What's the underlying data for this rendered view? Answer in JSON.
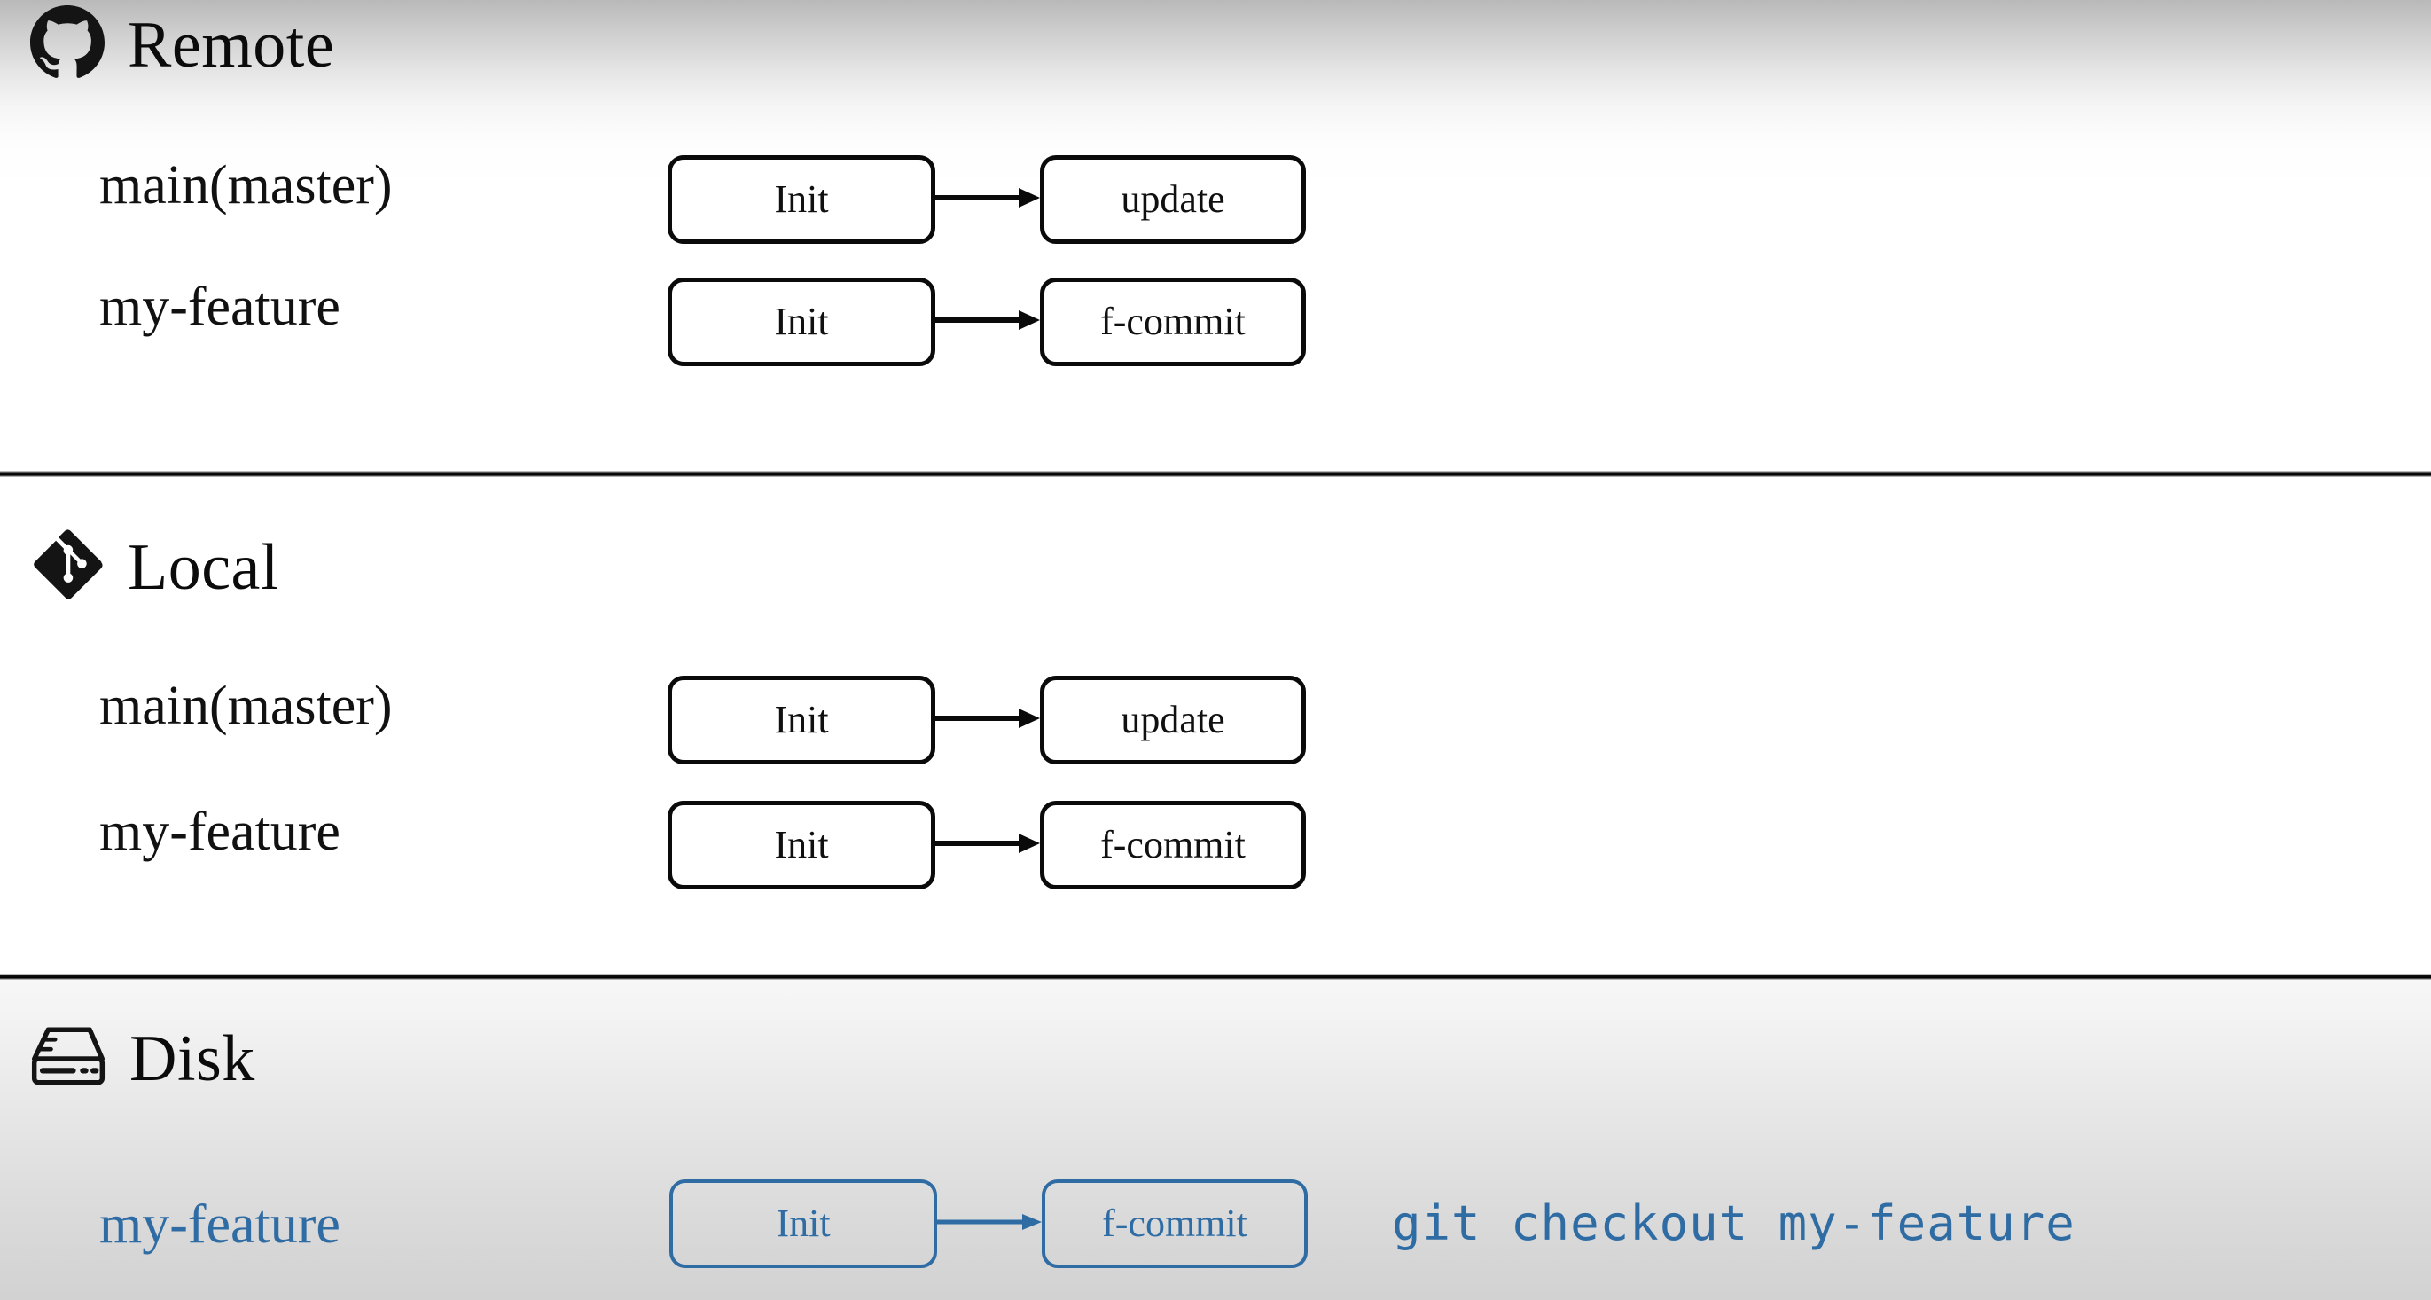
{
  "colors": {
    "accent_blue": "#2f6ca4",
    "ink": "#111111",
    "box_border": "#0a0a0a",
    "page_background": "#ffffff",
    "disk_background": "#dedede"
  },
  "sections": [
    {
      "id": "remote",
      "title": "Remote",
      "icon": "github-icon",
      "rows": [
        {
          "label": "main(master)",
          "accent": false,
          "commits": [
            "Init",
            "update"
          ]
        },
        {
          "label": "my-feature",
          "accent": false,
          "commits": [
            "Init",
            "f-commit"
          ]
        }
      ]
    },
    {
      "id": "local",
      "title": "Local",
      "icon": "git-icon",
      "rows": [
        {
          "label": "main(master)",
          "accent": false,
          "commits": [
            "Init",
            "update"
          ]
        },
        {
          "label": "my-feature",
          "accent": false,
          "commits": [
            "Init",
            "f-commit"
          ]
        }
      ]
    },
    {
      "id": "disk",
      "title": "Disk",
      "icon": "hard-drive-icon",
      "rows": [
        {
          "label": "my-feature",
          "accent": true,
          "commits": [
            "Init",
            "f-commit"
          ],
          "command": "git checkout my-feature"
        }
      ]
    }
  ]
}
